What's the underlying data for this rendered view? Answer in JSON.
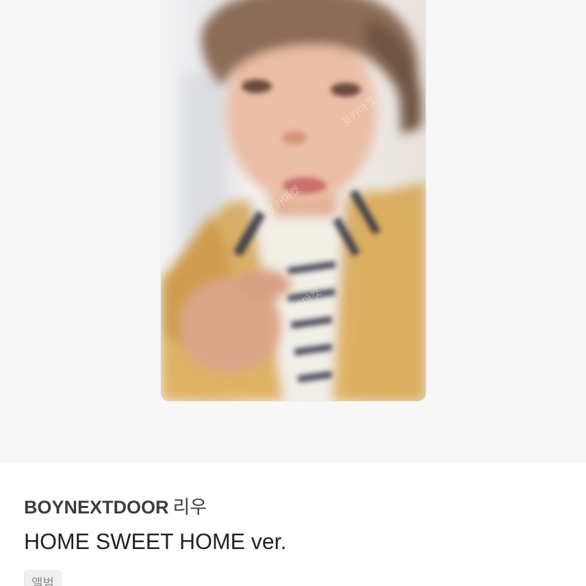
{
  "product": {
    "artist": "BOYNEXTDOOR",
    "member": "리우",
    "version": "HOME SWEET HOME ver.",
    "tag": "앨범"
  },
  "image": {
    "watermark_text": "포카마켓",
    "colors": {
      "cardigan": "#d9ad5f",
      "skin": "#e9b9a0",
      "hair": "#8a6b57",
      "background": "#eef0f2"
    }
  }
}
